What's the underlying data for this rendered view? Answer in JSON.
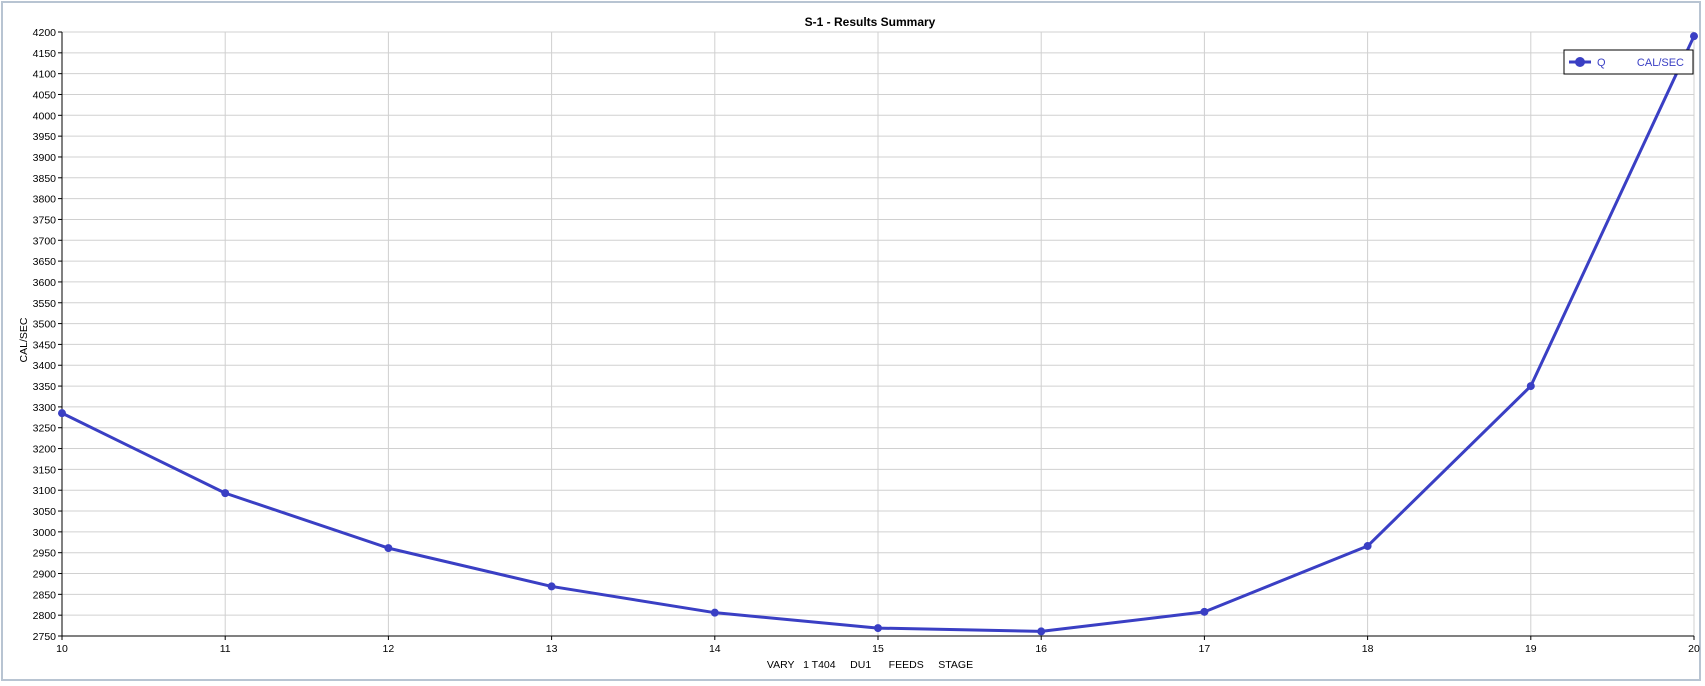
{
  "chart_data": {
    "type": "line",
    "title": "S-1 - Results Summary",
    "xlabel": "VARY   1 T404     DU1      FEEDS     STAGE",
    "ylabel": "CAL/SEC",
    "x": [
      10,
      11,
      12,
      13,
      14,
      15,
      16,
      17,
      18,
      19,
      20
    ],
    "xlim": [
      10,
      20
    ],
    "ylim": [
      2750,
      4200
    ],
    "ytick_step": 50,
    "grid": true,
    "legend_position": "top-right",
    "series": [
      {
        "name": "Q",
        "unit": "CAL/SEC",
        "color": "#3a3fc4",
        "values": [
          3285,
          3093,
          2961,
          2869,
          2806,
          2769,
          2761,
          2808,
          2966,
          3350,
          4190
        ]
      }
    ]
  },
  "colors": {
    "series_line": "#3a3fc4",
    "grid": "#d0d0d0",
    "frame_border": "#b8c4d2"
  }
}
